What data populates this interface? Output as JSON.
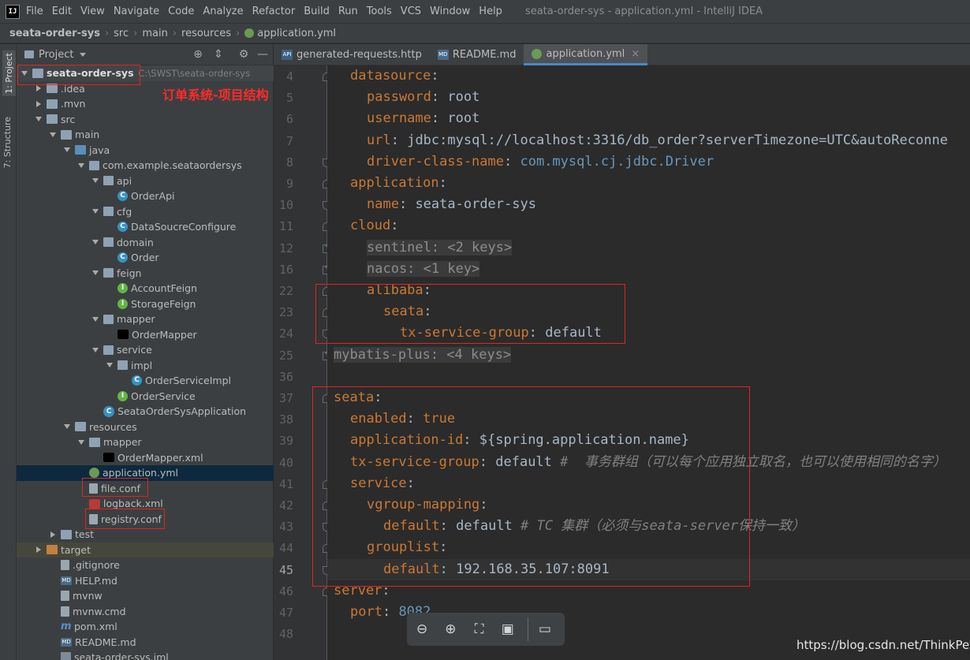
{
  "window": {
    "title": "seata-order-sys - application.yml - IntelliJ IDEA",
    "logo": "IJ"
  },
  "menu": [
    "File",
    "Edit",
    "View",
    "Navigate",
    "Code",
    "Analyze",
    "Refactor",
    "Build",
    "Run",
    "Tools",
    "VCS",
    "Window",
    "Help"
  ],
  "breadcrumb": [
    "seata-order-sys",
    "src",
    "main",
    "resources",
    "application.yml"
  ],
  "left_stripe": {
    "project_tab": "1: Project",
    "structure_tab": "7: Structure"
  },
  "project_panel": {
    "title": "Project",
    "root_name": "seata-order-sys",
    "root_path": "C:\\SWST\\seata-order-sys",
    "tree": [
      {
        "label": ".idea",
        "depth": 1,
        "arrow": "right",
        "icon": "folder"
      },
      {
        "label": ".mvn",
        "depth": 1,
        "arrow": "right",
        "icon": "folder"
      },
      {
        "label": "src",
        "depth": 1,
        "arrow": "down",
        "icon": "folder"
      },
      {
        "label": "main",
        "depth": 2,
        "arrow": "down",
        "icon": "folder"
      },
      {
        "label": "java",
        "depth": 3,
        "arrow": "down",
        "icon": "folder-src"
      },
      {
        "label": "com.example.seataordersys",
        "depth": 4,
        "arrow": "down",
        "icon": "pkg"
      },
      {
        "label": "api",
        "depth": 5,
        "arrow": "down",
        "icon": "pkg"
      },
      {
        "label": "OrderApi",
        "depth": 6,
        "arrow": "none",
        "icon": "cls"
      },
      {
        "label": "cfg",
        "depth": 5,
        "arrow": "down",
        "icon": "pkg"
      },
      {
        "label": "DataSoucreConfigure",
        "depth": 6,
        "arrow": "none",
        "icon": "cls"
      },
      {
        "label": "domain",
        "depth": 5,
        "arrow": "down",
        "icon": "pkg"
      },
      {
        "label": "Order",
        "depth": 6,
        "arrow": "none",
        "icon": "cls"
      },
      {
        "label": "feign",
        "depth": 5,
        "arrow": "down",
        "icon": "pkg"
      },
      {
        "label": "AccountFeign",
        "depth": 6,
        "arrow": "none",
        "icon": "intf"
      },
      {
        "label": "StorageFeign",
        "depth": 6,
        "arrow": "none",
        "icon": "intf"
      },
      {
        "label": "mapper",
        "depth": 5,
        "arrow": "down",
        "icon": "pkg"
      },
      {
        "label": "OrderMapper",
        "depth": 6,
        "arrow": "none",
        "icon": "mapper"
      },
      {
        "label": "service",
        "depth": 5,
        "arrow": "down",
        "icon": "pkg"
      },
      {
        "label": "impl",
        "depth": 6,
        "arrow": "down",
        "icon": "pkg"
      },
      {
        "label": "OrderServiceImpl",
        "depth": 7,
        "arrow": "none",
        "icon": "cls"
      },
      {
        "label": "OrderService",
        "depth": 6,
        "arrow": "none",
        "icon": "intf"
      },
      {
        "label": "SeataOrderSysApplication",
        "depth": 5,
        "arrow": "none",
        "icon": "app"
      },
      {
        "label": "resources",
        "depth": 3,
        "arrow": "down",
        "icon": "folder-res"
      },
      {
        "label": "mapper",
        "depth": 4,
        "arrow": "down",
        "icon": "folder"
      },
      {
        "label": "OrderMapper.xml",
        "depth": 5,
        "arrow": "none",
        "icon": "mapper"
      },
      {
        "label": "application.yml",
        "depth": 4,
        "arrow": "none",
        "icon": "yml",
        "selected": true
      },
      {
        "label": "file.conf",
        "depth": 4,
        "arrow": "none",
        "icon": "file"
      },
      {
        "label": "logback.xml",
        "depth": 4,
        "arrow": "none",
        "icon": "xml-red"
      },
      {
        "label": "registry.conf",
        "depth": 4,
        "arrow": "none",
        "icon": "file"
      },
      {
        "label": "test",
        "depth": 2,
        "arrow": "right",
        "icon": "folder"
      },
      {
        "label": "target",
        "depth": 1,
        "arrow": "right",
        "icon": "folder-orange",
        "highlight": true
      },
      {
        "label": ".gitignore",
        "depth": 2,
        "arrow": "none",
        "icon": "file"
      },
      {
        "label": "HELP.md",
        "depth": 2,
        "arrow": "none",
        "icon": "md"
      },
      {
        "label": "mvnw",
        "depth": 2,
        "arrow": "none",
        "icon": "file"
      },
      {
        "label": "mvnw.cmd",
        "depth": 2,
        "arrow": "none",
        "icon": "file"
      },
      {
        "label": "pom.xml",
        "depth": 2,
        "arrow": "none",
        "icon": "m-maven"
      },
      {
        "label": "README.md",
        "depth": 2,
        "arrow": "none",
        "icon": "md"
      },
      {
        "label": "seata-order-sys.iml",
        "depth": 2,
        "arrow": "none",
        "icon": "iml"
      }
    ]
  },
  "annotation": {
    "title": "订单系统-项目结构"
  },
  "editor_tabs": [
    {
      "label": "generated-requests.http",
      "icon": "http",
      "active": false
    },
    {
      "label": "README.md",
      "icon": "md",
      "active": false
    },
    {
      "label": "application.yml",
      "icon": "yml",
      "active": true
    }
  ],
  "editor": {
    "current_line": "45",
    "lines": [
      {
        "no": "4",
        "indent": 1,
        "key": "datasource",
        "sep": ":",
        "val": "",
        "fold": "open"
      },
      {
        "no": "5",
        "indent": 2,
        "key": "password",
        "sep": ": ",
        "val": "root"
      },
      {
        "no": "6",
        "indent": 2,
        "key": "username",
        "sep": ": ",
        "val": "root"
      },
      {
        "no": "7",
        "indent": 2,
        "key": "url",
        "sep": ": ",
        "val": "jdbc:mysql://localhost:3316/db_order?serverTimezone=UTC&autoReconne"
      },
      {
        "no": "8",
        "indent": 2,
        "key": "driver-class-name",
        "sep": ": ",
        "val": "com.mysql.cj.jdbc.Driver",
        "valclass": "val-blue",
        "fold": "close"
      },
      {
        "no": "9",
        "indent": 1,
        "key": "application",
        "sep": ":",
        "val": "",
        "fold": "open"
      },
      {
        "no": "10",
        "indent": 2,
        "key": "name",
        "sep": ": ",
        "val": "seata-order-sys",
        "fold": "close"
      },
      {
        "no": "11",
        "indent": 1,
        "key": "cloud",
        "sep": ":",
        "val": "",
        "fold": "open"
      },
      {
        "no": "12",
        "indent": 2,
        "key": "",
        "sep": "",
        "val": "sentinel: <2 keys>",
        "valclass": "folded",
        "fold": "collapsed"
      },
      {
        "no": "16",
        "indent": 2,
        "key": "",
        "sep": "",
        "val": "nacos: <1 key>",
        "valclass": "folded",
        "fold": "collapsed"
      },
      {
        "no": "22",
        "indent": 2,
        "key": "alibaba",
        "sep": ":",
        "val": "",
        "fold": "open"
      },
      {
        "no": "23",
        "indent": 3,
        "key": "seata",
        "sep": ":",
        "val": "",
        "fold": "open"
      },
      {
        "no": "24",
        "indent": 4,
        "key": "tx-service-group",
        "sep": ": ",
        "val": "default",
        "fold": "close"
      },
      {
        "no": "25",
        "indent": 0,
        "key": "",
        "sep": "",
        "val": "mybatis-plus: <4 keys>",
        "valclass": "folded",
        "fold": "collapsed"
      },
      {
        "no": "36",
        "indent": 0,
        "key": "",
        "sep": "",
        "val": ""
      },
      {
        "no": "37",
        "indent": 0,
        "key": "seata",
        "sep": ":",
        "val": "",
        "fold": "open"
      },
      {
        "no": "38",
        "indent": 1,
        "key": "enabled",
        "sep": ": ",
        "val": "true",
        "valclass": "key"
      },
      {
        "no": "39",
        "indent": 1,
        "key": "application-id",
        "sep": ": ",
        "val": "${spring.application.name}"
      },
      {
        "no": "40",
        "indent": 1,
        "key": "tx-service-group",
        "sep": ": ",
        "val": "default",
        "comment": " #  事务群组（可以每个应用独立取名，也可以使用相同的名字）"
      },
      {
        "no": "41",
        "indent": 1,
        "key": "service",
        "sep": ":",
        "val": "",
        "fold": "open"
      },
      {
        "no": "42",
        "indent": 2,
        "key": "vgroup-mapping",
        "sep": ":",
        "val": "",
        "fold": "open"
      },
      {
        "no": "43",
        "indent": 3,
        "key": "default",
        "sep": ": ",
        "val": "default",
        "comment": " # TC 集群（必须与seata-server保持一致）",
        "fold": "close"
      },
      {
        "no": "44",
        "indent": 2,
        "key": "grouplist",
        "sep": ":",
        "val": "",
        "fold": "open"
      },
      {
        "no": "45",
        "indent": 3,
        "key": "default",
        "sep": ": ",
        "val": "192.168.35.107:8091",
        "fold": "close"
      },
      {
        "no": "46",
        "indent": 0,
        "key": "server",
        "sep": ":",
        "val": "",
        "fold": "open"
      },
      {
        "no": "47",
        "indent": 1,
        "key": "port",
        "sep": ": ",
        "val": "8082",
        "valclass": "val-blue"
      },
      {
        "no": "48",
        "indent": 0,
        "key": "",
        "sep": "",
        "val": ""
      }
    ]
  },
  "toolbar": {
    "zoom_out_icon": "zoom-out-icon",
    "zoom_in_icon": "zoom-in-icon",
    "fit_icon": "fit-screen-icon",
    "present_icon": "present-icon",
    "comment_icon": "comment-icon"
  },
  "watermark": "https://blog.csdn.net/ThinkPet"
}
